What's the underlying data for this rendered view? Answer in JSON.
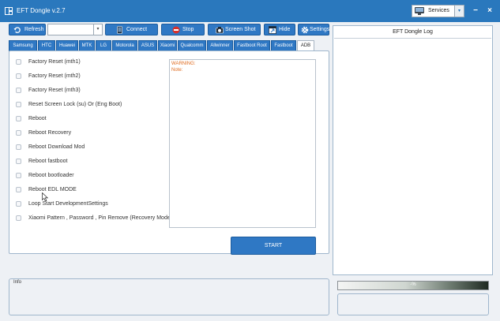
{
  "window": {
    "title": "EFT Dongle  v.2.7",
    "minimize_glyph": "−",
    "close_glyph": "×",
    "services_label": "Services",
    "services_caret": "▾"
  },
  "toolbar": {
    "refresh_label": "Refresh",
    "port_value": "",
    "port_caret": "▾",
    "connect_label": "Connect",
    "stop_label": "Stop",
    "screenshot_label": "Screen Shot",
    "hide_label": "Hide",
    "settings_label": "Settings"
  },
  "tabs": [
    {
      "label": "Samsung"
    },
    {
      "label": "HTC"
    },
    {
      "label": "Huawei"
    },
    {
      "label": "MTK"
    },
    {
      "label": "LG"
    },
    {
      "label": "Motorola"
    },
    {
      "label": "ASUS"
    },
    {
      "label": "Xiaomi"
    },
    {
      "label": "Qualcomm"
    },
    {
      "label": "Allwinner"
    },
    {
      "label": "Fastboot Root"
    },
    {
      "label": "Fastboot"
    },
    {
      "label": "ADB"
    }
  ],
  "active_tab": "ADB",
  "options": [
    {
      "label": "Factory Reset (mth1)",
      "checked": false
    },
    {
      "label": "Factory Reset (mth2)",
      "checked": false
    },
    {
      "label": "Factory Reset (mth3)",
      "checked": false
    },
    {
      "label": "Reset Screen Lock (su) Or  (Eng Boot)",
      "checked": false
    },
    {
      "label": "Reboot",
      "checked": false
    },
    {
      "label": "Reboot Recovery",
      "checked": false
    },
    {
      "label": "Reboot Download Mod",
      "checked": false
    },
    {
      "label": "Reboot fastboot",
      "checked": false
    },
    {
      "label": "Reboot bootloader",
      "checked": false
    },
    {
      "label": "Reboot EDL MODE",
      "checked": false
    },
    {
      "label": "Loop Start  DevelopmentSettings",
      "checked": false
    },
    {
      "label": "Xiaomi Pattern , Password , Pin Remove (Recovery Mode)",
      "checked": false
    }
  ],
  "notes": {
    "warning": "WARNING:",
    "note": "Note:"
  },
  "start_label": "START",
  "log": {
    "title": "EFT Dongle Log"
  },
  "info": {
    "label": "Info"
  },
  "progress": {
    "percent": 0,
    "text": "-%"
  },
  "colors": {
    "titlebar": "#2a78bd",
    "button": "#2f78c4",
    "warning_text": "#e06b1f"
  }
}
